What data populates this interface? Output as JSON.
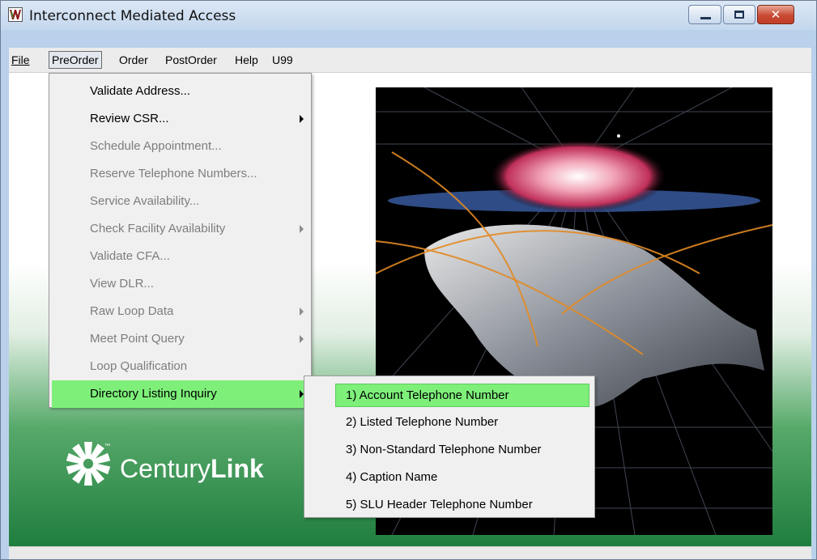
{
  "window": {
    "title": "Interconnect Mediated Access",
    "close_glyph": "✕"
  },
  "menubar": {
    "items": [
      "File",
      "PreOrder",
      "Order",
      "PostOrder",
      "Help",
      "U99"
    ]
  },
  "preorder_menu": {
    "items": [
      {
        "label": "Validate Address...",
        "enabled": true,
        "submenu": false
      },
      {
        "label": "Review CSR...",
        "enabled": true,
        "submenu": true
      },
      {
        "label": "Schedule Appointment...",
        "enabled": false,
        "submenu": false
      },
      {
        "label": "Reserve Telephone Numbers...",
        "enabled": false,
        "submenu": false
      },
      {
        "label": "Service Availability...",
        "enabled": false,
        "submenu": false
      },
      {
        "label": "Check Facility Availability",
        "enabled": false,
        "submenu": true
      },
      {
        "label": "Validate CFA...",
        "enabled": false,
        "submenu": false
      },
      {
        "label": "View DLR...",
        "enabled": false,
        "submenu": false
      },
      {
        "label": "Raw Loop Data",
        "enabled": false,
        "submenu": true
      },
      {
        "label": "Meet Point Query",
        "enabled": false,
        "submenu": true
      },
      {
        "label": "Loop Qualification",
        "enabled": false,
        "submenu": false
      },
      {
        "label": "Directory Listing Inquiry",
        "enabled": true,
        "submenu": true,
        "highlighted": true
      }
    ]
  },
  "directory_listing_submenu": {
    "items": [
      {
        "label": "1) Account Telephone Number",
        "highlighted": true
      },
      {
        "label": "2) Listed Telephone Number"
      },
      {
        "label": "3) Non-Standard Telephone Number"
      },
      {
        "label": "4) Caption Name"
      },
      {
        "label": "5) SLU Header Telephone Number"
      }
    ]
  },
  "branding": {
    "logo_text_regular": "Century",
    "logo_text_bold": "Link",
    "trademark": "™"
  },
  "colors": {
    "highlight": "#7ef07a",
    "menu_bg": "#f0f0f0",
    "disabled_text": "#7d7d7d",
    "gradient_green": "#1f7e3e"
  }
}
